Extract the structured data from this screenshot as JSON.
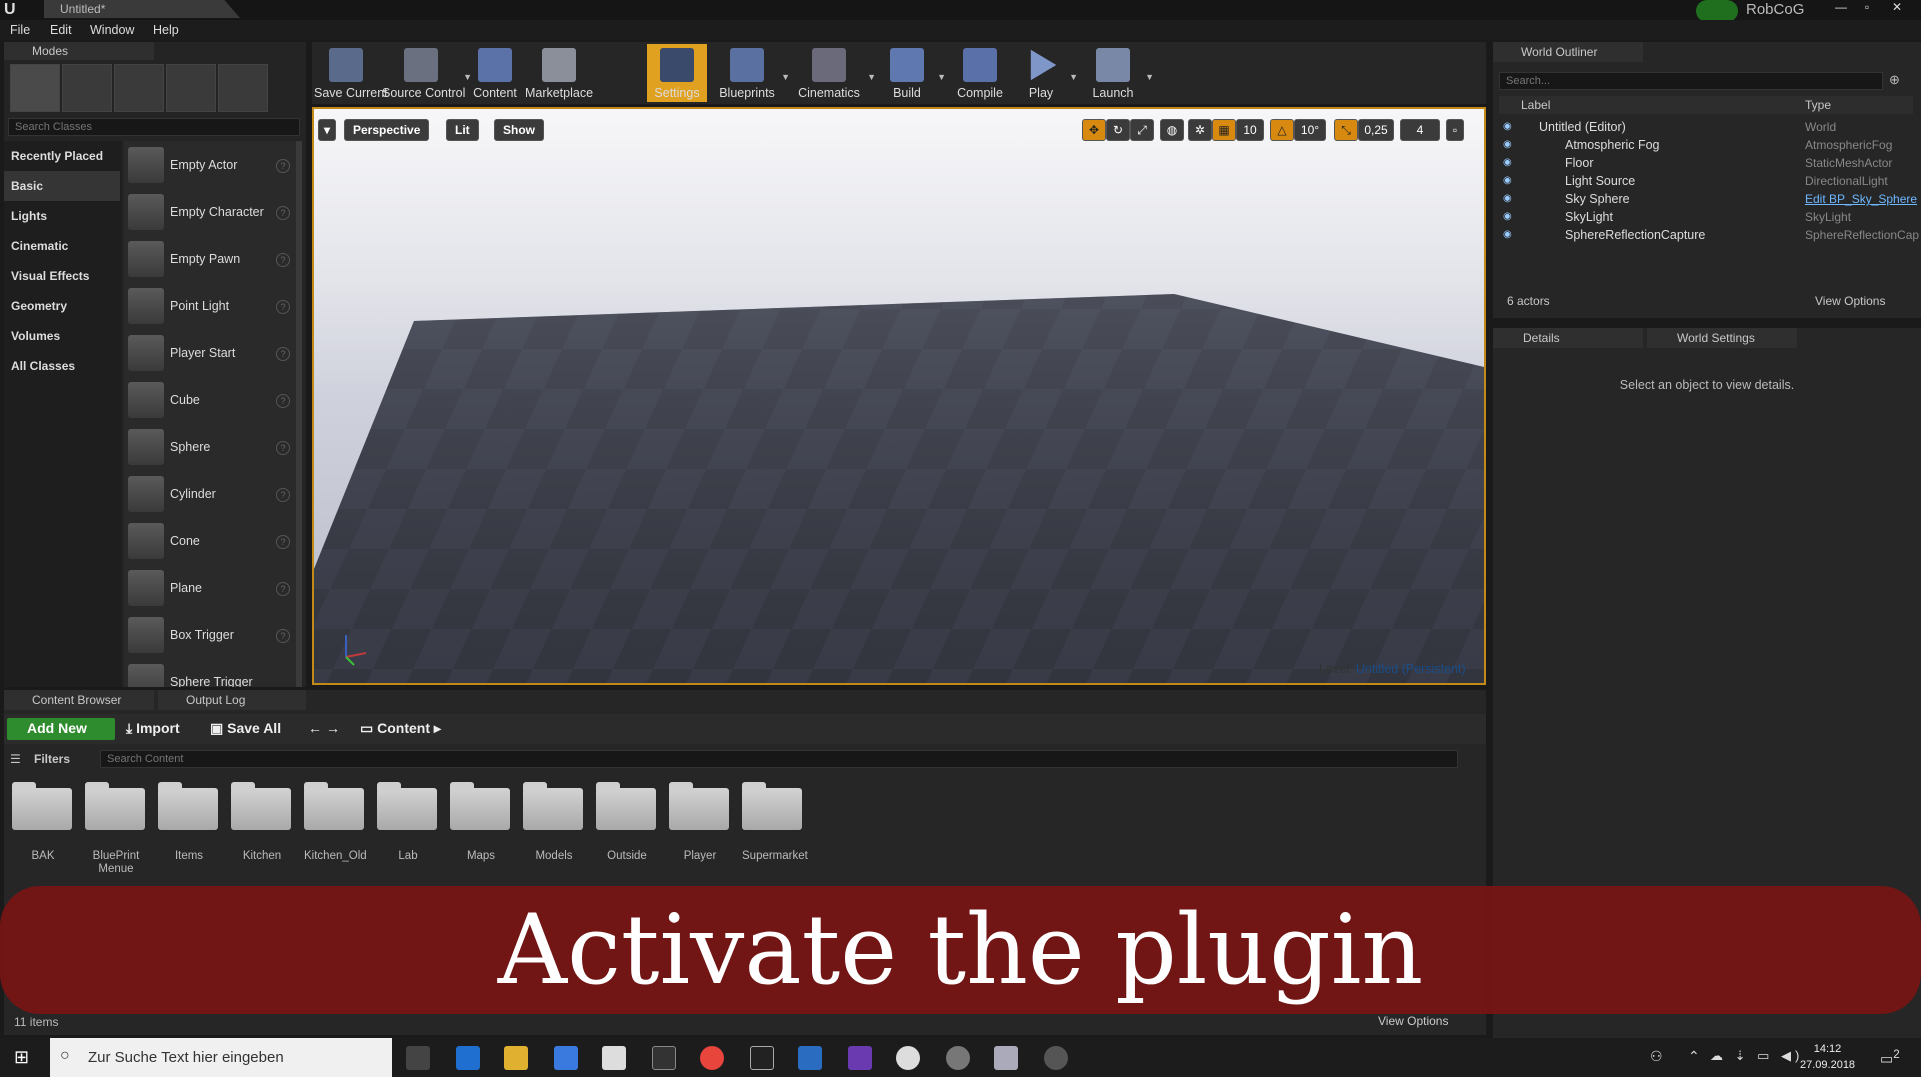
{
  "window": {
    "doc_title": "Untitled*",
    "user": "RobCoG",
    "controls": [
      "—",
      "▫",
      "✕"
    ]
  },
  "menu": [
    "File",
    "Edit",
    "Window",
    "Help"
  ],
  "modes": {
    "tab_label": "Modes",
    "search_placeholder": "Search Classes",
    "categories": [
      "Recently Placed",
      "Basic",
      "Lights",
      "Cinematic",
      "Visual Effects",
      "Geometry",
      "Volumes",
      "All Classes"
    ],
    "actors": [
      "Empty Actor",
      "Empty Character",
      "Empty Pawn",
      "Point Light",
      "Player Start",
      "Cube",
      "Sphere",
      "Cylinder",
      "Cone",
      "Plane",
      "Box Trigger",
      "Sphere Trigger"
    ]
  },
  "toolbar": {
    "buttons": [
      "Save Current",
      "Source Control",
      "Content",
      "Marketplace",
      "Settings",
      "Blueprints",
      "Cinematics",
      "Build",
      "Compile",
      "Play",
      "Launch"
    ]
  },
  "viewport": {
    "perspective_label": "Perspective",
    "lit_label": "Lit",
    "show_label": "Show",
    "grid_snap": "10",
    "rot_snap": "10°",
    "scale_snap": "0,25",
    "cam_speed": "4",
    "level_label": "Level:",
    "level_value": "Untitled (Persistent)"
  },
  "outliner": {
    "tab_label": "World Outliner",
    "search_placeholder": "Search...",
    "col_label": "Label",
    "col_type": "Type",
    "rows": [
      {
        "label": "Untitled (Editor)",
        "type": "World"
      },
      {
        "label": "Atmospheric Fog",
        "type": "AtmosphericFog"
      },
      {
        "label": "Floor",
        "type": "StaticMeshActor"
      },
      {
        "label": "Light Source",
        "type": "DirectionalLight"
      },
      {
        "label": "Sky Sphere",
        "type": "Edit BP_Sky_Sphere"
      },
      {
        "label": "SkyLight",
        "type": "SkyLight"
      },
      {
        "label": "SphereReflectionCapture",
        "type": "SphereReflectionCap"
      }
    ],
    "count": "6 actors",
    "view_options": "View Options"
  },
  "details": {
    "tab_details": "Details",
    "tab_world": "World Settings",
    "message": "Select an object to view details."
  },
  "content_browser": {
    "tab_label": "Content Browser",
    "tab_output": "Output Log",
    "add_new": "Add New",
    "import": "Import",
    "save_all": "Save All",
    "path": "Content",
    "filters": "Filters",
    "search_placeholder": "Search Content",
    "folders": [
      "BAK",
      "BluePrint Menue",
      "Items",
      "Kitchen",
      "Kitchen_Old",
      "Lab",
      "Maps",
      "Models",
      "Outside",
      "Player",
      "Supermarket"
    ],
    "count": "11 items",
    "view_options": "View Options"
  },
  "banner": "Activate the plugin",
  "taskbar": {
    "search_placeholder": "Zur Suche Text hier eingeben",
    "time": "14:12",
    "date": "27.09.2018",
    "notify_count": "2"
  }
}
